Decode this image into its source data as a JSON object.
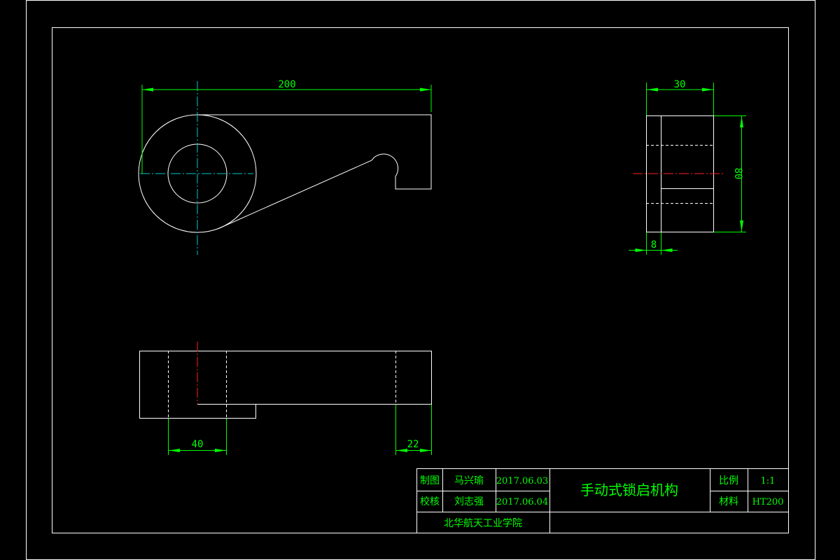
{
  "drawing": {
    "dimensions": {
      "front_length": "200",
      "side_width": "30",
      "side_height": "80",
      "side_offset": "8",
      "top_hole_width": "40",
      "top_slot_width": "22"
    }
  },
  "title_block": {
    "drawn_label": "制图",
    "drawn_by": "马兴瑜",
    "drawn_date": "2017.06.03",
    "checked_label": "校核",
    "checked_by": "刘志强",
    "checked_date": "2017.06.04",
    "title": "手动式锁启机构",
    "scale_label": "比例",
    "scale_value": "1:1",
    "material_label": "材料",
    "material_value": "HT200",
    "institution": "北华航天工业学院"
  },
  "colors": {
    "background": "#000000",
    "outline": "#ffffff",
    "dimension": "#00ff00",
    "centerline_front": "#00c8c8",
    "centerline_side": "#ff2020"
  }
}
